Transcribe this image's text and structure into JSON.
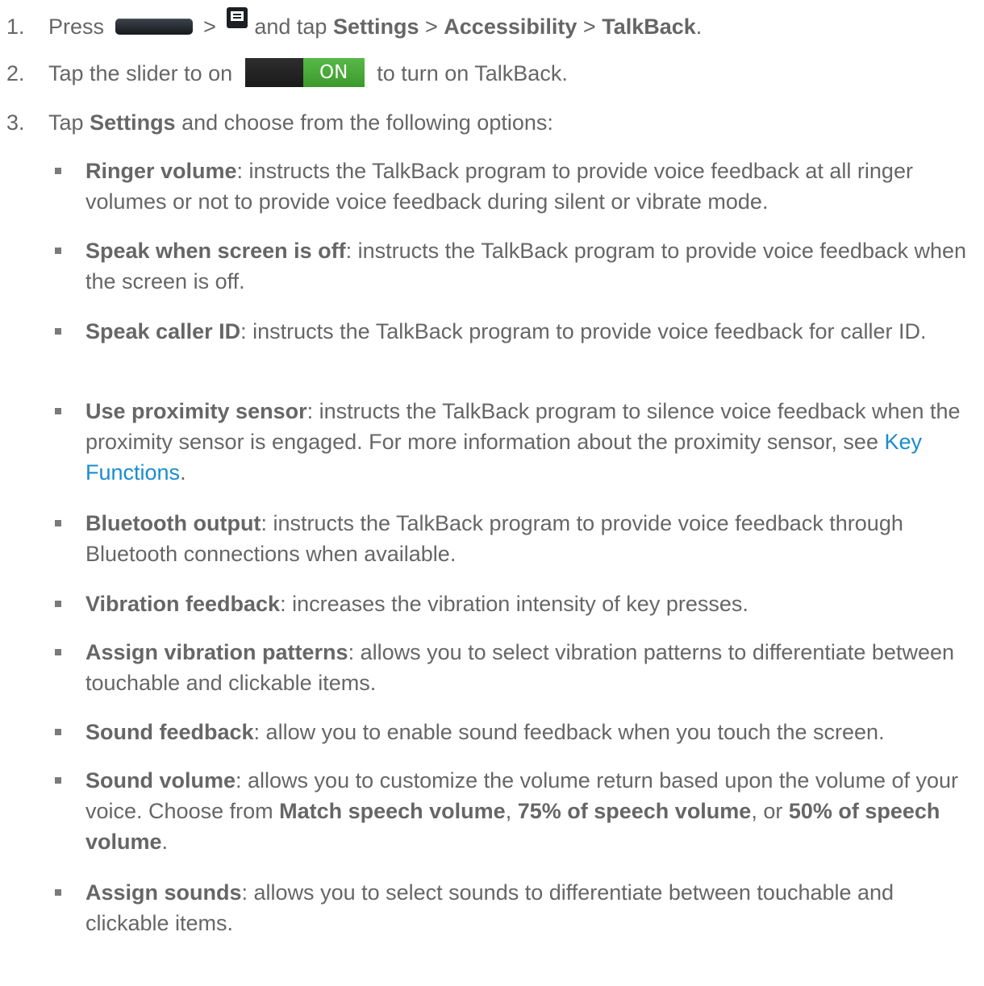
{
  "steps": [
    {
      "number": "1.",
      "press": "Press",
      "sep1": ">",
      "after_menu": "and tap",
      "settings": "Settings",
      "sep2": ">",
      "accessibility": "Accessibility",
      "sep3": ">",
      "talkback": "TalkBack",
      "end": ".",
      "home_key_icon": "home-key-icon",
      "menu_key_icon": "menu-key-icon"
    },
    {
      "number": "2.",
      "before": "Tap the slider to on",
      "toggle_label": "ON",
      "after": "to turn on TalkBack."
    },
    {
      "number": "3.",
      "tap": "Tap",
      "settings": "Settings",
      "rest": "and choose from the following options:"
    }
  ],
  "options": [
    {
      "term": "Ringer volume",
      "text": ": instructs the TalkBack program to provide voice feedback at all ringer volumes or not to provide voice feedback during silent or vibrate mode."
    },
    {
      "term": "Speak when screen is off",
      "text": ": instructs the TalkBack program to provide voice feedback when the screen is off."
    },
    {
      "term": "Speak caller ID",
      "text": ": instructs the TalkBack program to provide voice feedback for caller ID."
    },
    {
      "term": "Use proximity sensor",
      "text": ": instructs the TalkBack program to silence voice feedback when the proximity sensor is engaged. For more information about the proximity sensor, see ",
      "link": "Key Functions",
      "end": "."
    },
    {
      "term": "Bluetooth output",
      "text": ": instructs the TalkBack program to provide voice feedback through Bluetooth connections when available."
    },
    {
      "term": "Vibration feedback",
      "text": ": increases the vibration intensity of key presses."
    },
    {
      "term": "Assign vibration patterns",
      "text": ": allows you to select vibration patterns to differentiate between touchable and clickable items."
    },
    {
      "term": "Sound feedback",
      "text": ": allow you to enable sound feedback when you touch the screen."
    },
    {
      "term": "Sound volume",
      "text": ": allows you to customize the volume return based upon the volume of your voice. Choose from ",
      "choice1": "Match speech volume",
      "sep1": ", ",
      "choice2": "75% of speech volume",
      "sep2": ", or ",
      "choice3": "50% of speech volume",
      "end": "."
    },
    {
      "term": "Assign sounds",
      "text": ": allows you to select sounds to differentiate between touchable and clickable items."
    }
  ],
  "colors": {
    "text": "#666666",
    "link": "#1a8ccf",
    "toggle_on": "#4caf3e"
  }
}
